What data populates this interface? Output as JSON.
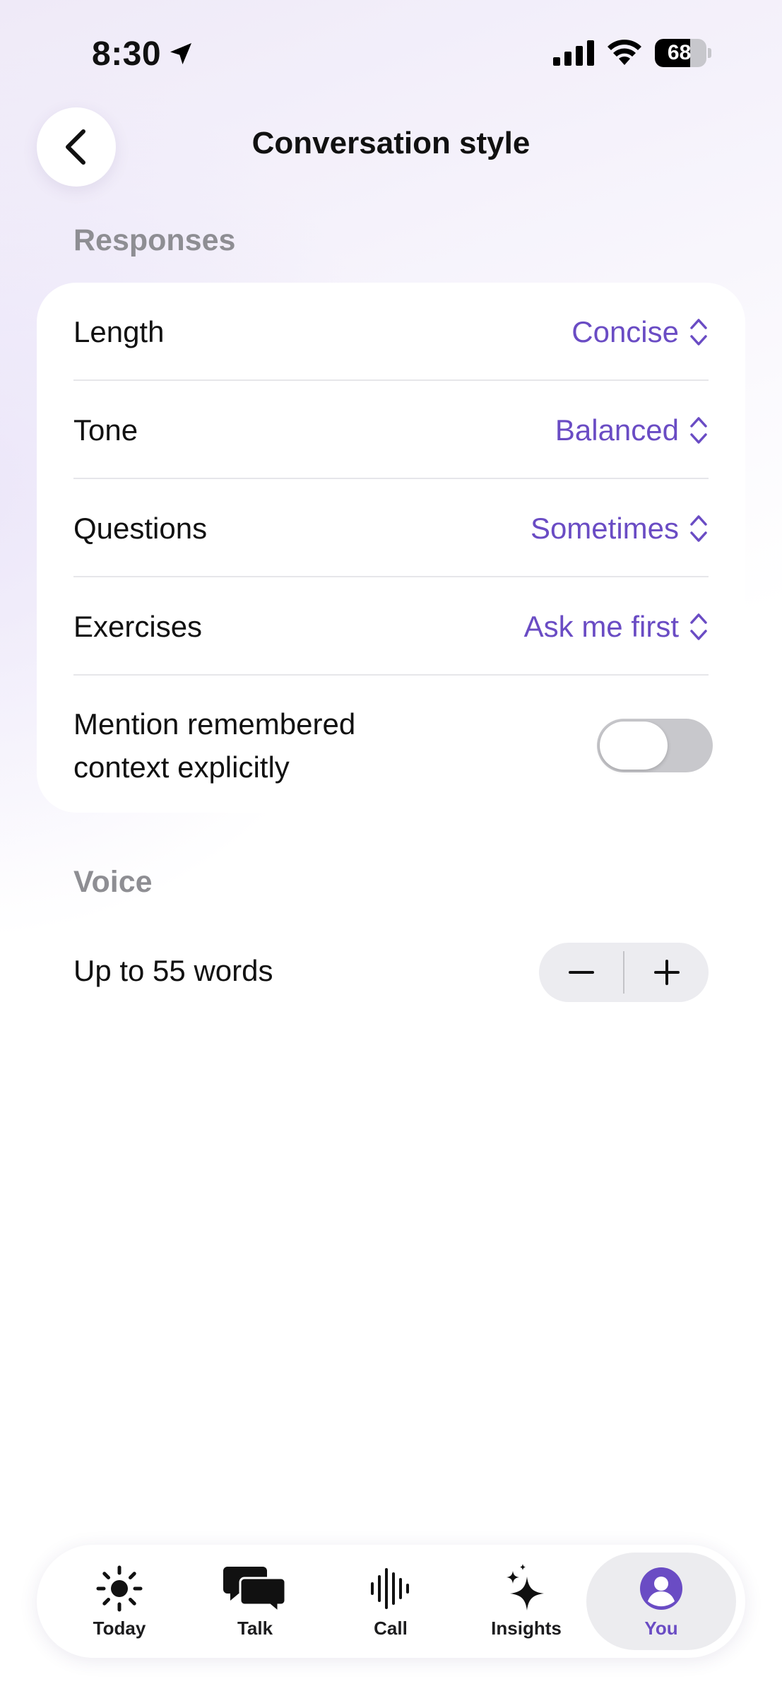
{
  "status_bar": {
    "time": "8:30",
    "battery": "68",
    "battery_level": 0.68,
    "icons": [
      "location-arrow-icon",
      "cellular-signal-icon",
      "wifi-icon",
      "battery-icon"
    ]
  },
  "header": {
    "title": "Conversation style",
    "back_icon": "chevron-left-icon"
  },
  "responses": {
    "section_label": "Responses",
    "rows": [
      {
        "label": "Length",
        "value": "Concise"
      },
      {
        "label": "Tone",
        "value": "Balanced"
      },
      {
        "label": "Questions",
        "value": "Sometimes"
      },
      {
        "label": "Exercises",
        "value": "Ask me first"
      }
    ],
    "toggle": {
      "label_line1": "Mention remembered",
      "label_line2": "context explicitly",
      "on": false
    }
  },
  "voice": {
    "section_label": "Voice",
    "label": "Up to 55 words",
    "decrement_icon": "minus-icon",
    "increment_icon": "plus-icon"
  },
  "tabbar": {
    "tabs": [
      {
        "label": "Today",
        "icon": "sun-icon",
        "active": false
      },
      {
        "label": "Talk",
        "icon": "chat-bubbles-icon",
        "active": false
      },
      {
        "label": "Call",
        "icon": "waveform-icon",
        "active": false
      },
      {
        "label": "Insights",
        "icon": "sparkles-icon",
        "active": false
      },
      {
        "label": "You",
        "icon": "person-circle-icon",
        "active": true
      }
    ]
  },
  "colors": {
    "accent": "#6a4cc4",
    "secondary_text": "#8e8e93",
    "toggle_off": "#c8c8cc"
  }
}
